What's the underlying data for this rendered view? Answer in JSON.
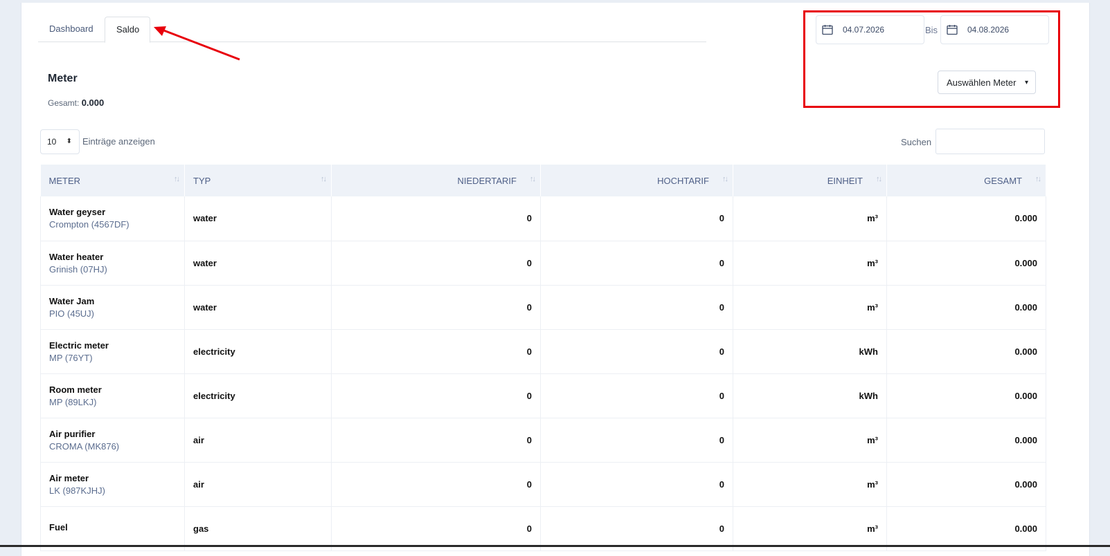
{
  "tabs": [
    {
      "label": "Dashboard"
    },
    {
      "label": "Saldo"
    }
  ],
  "heading": {
    "title": "Meter",
    "total_label": "Gesamt:",
    "total_value": "0.000"
  },
  "date_range": {
    "from": "04.07.2026",
    "separator": "Bis",
    "to": "04.08.2026"
  },
  "meter_select": {
    "label": "Auswählen Meter"
  },
  "length": {
    "value": "10",
    "label": "Einträge anzeigen"
  },
  "search": {
    "label": "Suchen",
    "value": ""
  },
  "table": {
    "columns": [
      "METER",
      "TYP",
      "NIEDERTARIF",
      "HOCHTARIF",
      "EINHEIT",
      "GESAMT"
    ],
    "rows": [
      {
        "name": "Water geyser",
        "sub": "Crompton (4567DF)",
        "type": "water",
        "low": "0",
        "high": "0",
        "unit": "m³",
        "total": "0.000"
      },
      {
        "name": "Water heater",
        "sub": "Grinish (07HJ)",
        "type": "water",
        "low": "0",
        "high": "0",
        "unit": "m³",
        "total": "0.000"
      },
      {
        "name": "Water Jam",
        "sub": "PIO (45UJ)",
        "type": "water",
        "low": "0",
        "high": "0",
        "unit": "m³",
        "total": "0.000"
      },
      {
        "name": "Electric meter",
        "sub": "MP (76YT)",
        "type": "electricity",
        "low": "0",
        "high": "0",
        "unit": "kWh",
        "total": "0.000"
      },
      {
        "name": "Room meter",
        "sub": "MP (89LKJ)",
        "type": "electricity",
        "low": "0",
        "high": "0",
        "unit": "kWh",
        "total": "0.000"
      },
      {
        "name": "Air purifier",
        "sub": "CROMA (MK876)",
        "type": "air",
        "low": "0",
        "high": "0",
        "unit": "m³",
        "total": "0.000"
      },
      {
        "name": "Air meter",
        "sub": "LK (987KJHJ)",
        "type": "air",
        "low": "0",
        "high": "0",
        "unit": "m³",
        "total": "0.000"
      },
      {
        "name": "Fuel",
        "sub": "",
        "type": "gas",
        "low": "0",
        "high": "0",
        "unit": "m³",
        "total": "0.000"
      }
    ]
  },
  "colors": {
    "accent": "#4e5f87",
    "annotation": "#e8000b",
    "header_bg": "#eef2f8"
  }
}
